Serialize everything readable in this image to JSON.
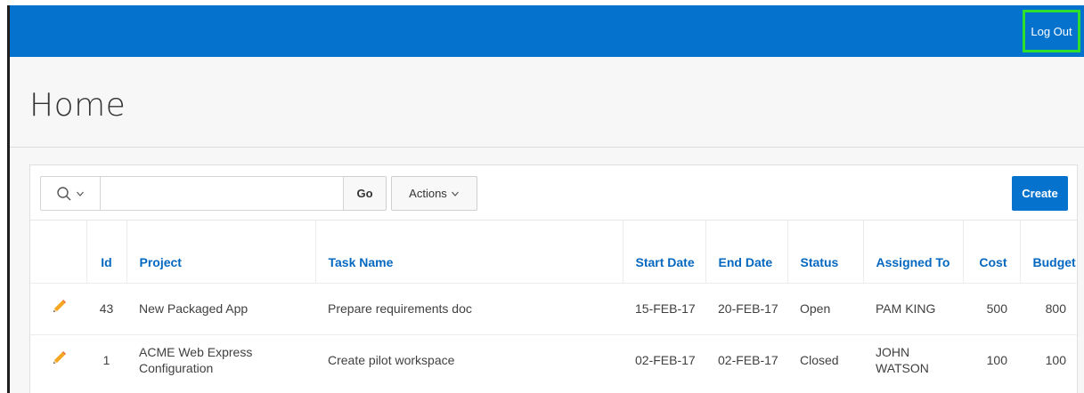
{
  "header": {
    "logout_label": "Log Out",
    "colors": {
      "bar": "#0572ce",
      "highlight": "#2ee02e"
    }
  },
  "page": {
    "title": "Home"
  },
  "toolbar": {
    "search_icon": "search-icon",
    "search_placeholder": "",
    "go_label": "Go",
    "actions_label": "Actions",
    "create_label": "Create"
  },
  "table": {
    "columns": {
      "id": "Id",
      "project": "Project",
      "task_name": "Task Name",
      "start_date": "Start Date",
      "end_date": "End Date",
      "status": "Status",
      "assigned_to": "Assigned To",
      "cost": "Cost",
      "budget": "Budget"
    },
    "rows": [
      {
        "edit_icon": "pencil-icon",
        "id": "43",
        "project": "New Packaged App",
        "task_name": "Prepare requirements doc",
        "start_date": "15-FEB-17",
        "end_date": "20-FEB-17",
        "status": "Open",
        "assigned_to": "PAM KING",
        "cost": "500",
        "budget": "800"
      },
      {
        "edit_icon": "pencil-icon",
        "id": "1",
        "project": "ACME Web Express Configuration",
        "task_name": "Create pilot workspace",
        "start_date": "02-FEB-17",
        "end_date": "02-FEB-17",
        "status": "Closed",
        "assigned_to": "JOHN WATSON",
        "cost": "100",
        "budget": "100"
      }
    ]
  }
}
